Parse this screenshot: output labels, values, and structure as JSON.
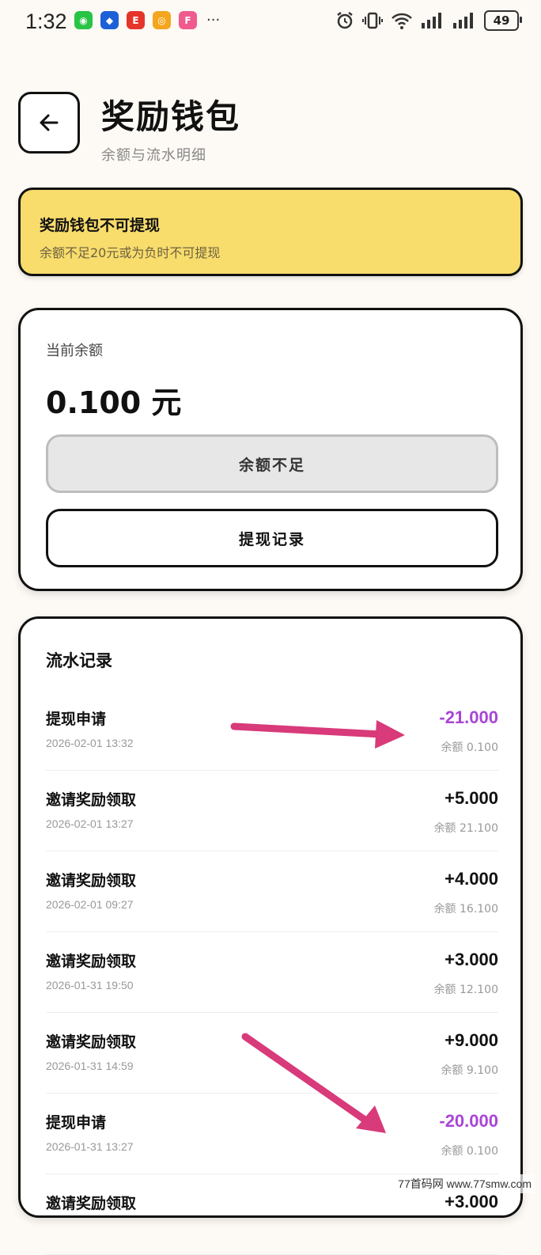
{
  "status_bar": {
    "time": "1:32",
    "battery": "49",
    "apps": [
      {
        "icon": "wechat-icon",
        "color": "#28c445",
        "glyph": "◉"
      },
      {
        "icon": "app-blue-icon",
        "color": "#1d5fd6",
        "glyph": "◆"
      },
      {
        "icon": "earn-icon",
        "color": "#e5352b",
        "glyph": "E"
      },
      {
        "icon": "weibo-icon",
        "color": "#f4a61f",
        "glyph": "◎"
      },
      {
        "icon": "app-colorful-icon",
        "color": "#ef5a8f",
        "glyph": "F"
      }
    ],
    "more": "···"
  },
  "header": {
    "title": "奖励钱包",
    "subtitle": "余额与流水明细"
  },
  "notice": {
    "title": "奖励钱包不可提现",
    "desc": "余额不足20元或为负时不可提现"
  },
  "balance": {
    "label": "当前余额",
    "amount": "0.100 元",
    "insufficient_label": "余额不足",
    "records_label": "提现记录"
  },
  "flow": {
    "title": "流水记录",
    "rows": [
      {
        "title": "提现申请",
        "date": "2026-02-01 13:32",
        "amount": "-21.000",
        "balance": "余额 0.100",
        "negative": true
      },
      {
        "title": "邀请奖励领取",
        "date": "2026-02-01 13:27",
        "amount": "+5.000",
        "balance": "余额 21.100",
        "negative": false
      },
      {
        "title": "邀请奖励领取",
        "date": "2026-02-01 09:27",
        "amount": "+4.000",
        "balance": "余额 16.100",
        "negative": false
      },
      {
        "title": "邀请奖励领取",
        "date": "2026-01-31 19:50",
        "amount": "+3.000",
        "balance": "余额 12.100",
        "negative": false
      },
      {
        "title": "邀请奖励领取",
        "date": "2026-01-31 14:59",
        "amount": "+9.000",
        "balance": "余额 9.100",
        "negative": false
      },
      {
        "title": "提现申请",
        "date": "2026-01-31 13:27",
        "amount": "-20.000",
        "balance": "余额 0.100",
        "negative": true
      },
      {
        "title": "邀请奖励领取",
        "date": "",
        "amount": "+3.000",
        "balance": "",
        "negative": false
      }
    ]
  },
  "colors": {
    "background": "#fdf9f4",
    "notice_bg": "#f8dc6c",
    "negative_amount": "#a845d6",
    "annotation_arrow": "#d83a7a"
  },
  "watermark": "77首码网 www.77smw.com"
}
